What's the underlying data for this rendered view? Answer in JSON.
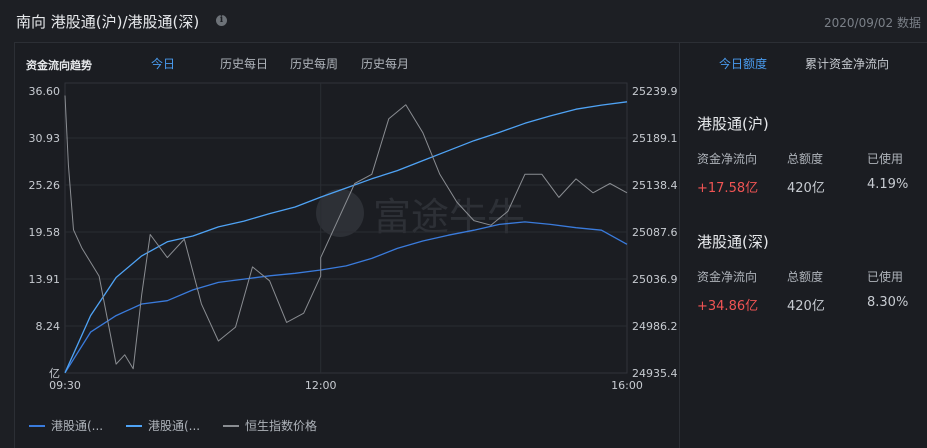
{
  "header": {
    "title": "南向 港股通(沪)/港股通(深)",
    "info_icon": "info-icon",
    "date": "2020/09/02 数据"
  },
  "chart_panel": {
    "title": "资金流向趋势",
    "tabs": [
      "今日",
      "历史每日",
      "历史每周",
      "历史每月"
    ],
    "active_tab": 0,
    "watermark": "富途牛牛"
  },
  "chart_data": {
    "type": "line",
    "x_ticks": [
      "09:30",
      "12:00",
      "16:00"
    ],
    "y_left_ticks": [
      "36.60",
      "30.93",
      "25.26",
      "19.58",
      "13.91",
      "8.24",
      "亿"
    ],
    "y_right_ticks": [
      "25239.9",
      "25189.1",
      "25138.4",
      "25087.6",
      "25036.9",
      "24986.2",
      "24935.4"
    ],
    "y_left_range": [
      2.57,
      36.6
    ],
    "y_right_range": [
      24935.4,
      25239.9
    ],
    "legend": [
      "港股通(...",
      "港股通(...",
      "恒生指数价格"
    ],
    "series": [
      {
        "name": "港股通(沪)",
        "axis": "left",
        "color": "#3a7bdc",
        "x": [
          "09:30",
          "09:45",
          "10:00",
          "10:15",
          "10:30",
          "10:45",
          "11:00",
          "11:15",
          "11:30",
          "11:45",
          "12:00",
          "13:15",
          "13:30",
          "13:45",
          "14:00",
          "14:15",
          "14:30",
          "14:45",
          "15:00",
          "15:15",
          "15:30",
          "15:45",
          "16:00"
        ],
        "values": [
          2.6,
          7.5,
          9.5,
          10.9,
          11.3,
          12.6,
          13.5,
          13.9,
          14.3,
          14.6,
          15.0,
          15.5,
          16.4,
          17.6,
          18.5,
          19.2,
          19.8,
          20.5,
          20.8,
          20.5,
          20.1,
          19.8,
          18.1
        ]
      },
      {
        "name": "港股通(深)",
        "axis": "left",
        "color": "#4fa3f5",
        "x": [
          "09:30",
          "09:45",
          "10:00",
          "10:15",
          "10:30",
          "10:45",
          "11:00",
          "11:15",
          "11:30",
          "11:45",
          "12:00",
          "13:15",
          "13:30",
          "13:45",
          "14:00",
          "14:15",
          "14:30",
          "14:45",
          "15:00",
          "15:15",
          "15:30",
          "15:45",
          "16:00"
        ],
        "values": [
          2.6,
          9.5,
          14.1,
          16.7,
          18.4,
          19.1,
          20.2,
          20.9,
          21.8,
          22.6,
          23.8,
          24.9,
          26.0,
          27.0,
          28.2,
          29.4,
          30.6,
          31.6,
          32.7,
          33.6,
          34.4,
          34.9,
          35.3
        ]
      },
      {
        "name": "恒生指数价格",
        "axis": "right",
        "color": "#8a8d92",
        "x": [
          "09:30",
          "09:32",
          "09:35",
          "09:40",
          "09:50",
          "10:00",
          "10:05",
          "10:10",
          "10:15",
          "10:20",
          "10:30",
          "10:40",
          "10:50",
          "11:00",
          "11:10",
          "11:20",
          "11:30",
          "11:40",
          "11:50",
          "12:00",
          "13:00",
          "13:10",
          "13:20",
          "13:30",
          "13:40",
          "13:50",
          "14:00",
          "14:10",
          "14:20",
          "14:30",
          "14:40",
          "14:50",
          "15:00",
          "15:10",
          "15:20",
          "15:30",
          "15:40",
          "15:50",
          "16:00"
        ],
        "values": [
          25235,
          25160,
          25090,
          25070,
          25040,
          24945,
          24955,
          24940,
          25020,
          25085,
          25060,
          25080,
          25010,
          24970,
          24985,
          25050,
          25035,
          24990,
          25000,
          25040,
          25060,
          25100,
          25140,
          25150,
          25210,
          25225,
          25195,
          25150,
          25120,
          25100,
          25095,
          25110,
          25150,
          25150,
          25125,
          25145,
          25130,
          25140,
          25130
        ]
      }
    ]
  },
  "right_panel": {
    "tabs": [
      "今日额度",
      "累计资金净流向"
    ],
    "active_tab": 0,
    "sections": [
      {
        "title": "港股通(沪)",
        "labels": [
          "资金净流向",
          "总额度",
          "已使用"
        ],
        "net_flow": "+17.58亿",
        "total": "420亿",
        "used": "4.19%"
      },
      {
        "title": "港股通(深)",
        "labels": [
          "资金净流向",
          "总额度",
          "已使用"
        ],
        "net_flow": "+34.86亿",
        "total": "420亿",
        "used": "8.30%"
      }
    ]
  }
}
